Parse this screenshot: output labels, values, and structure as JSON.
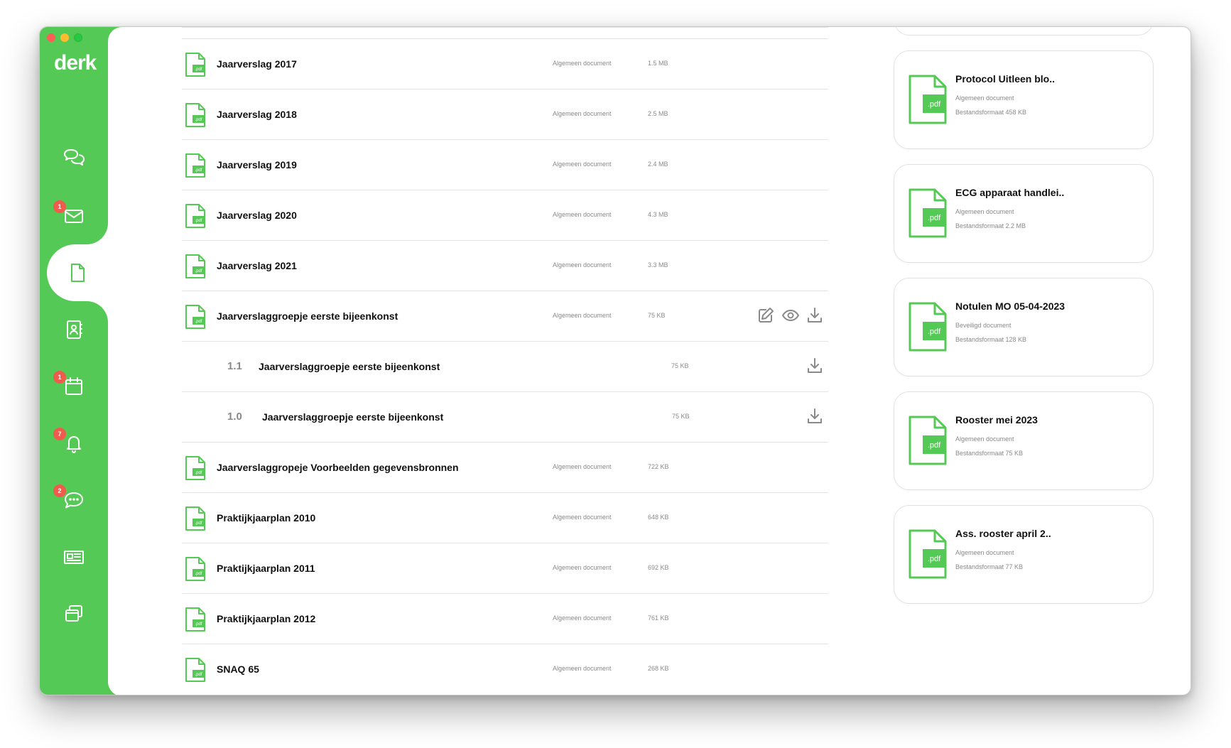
{
  "app": {
    "logo": "derk",
    "accent": "#55c955",
    "badge_color": "#ef5b4c"
  },
  "sidebar": {
    "items": [
      {
        "icon": "chat-bubbles-icon",
        "badge": ""
      },
      {
        "icon": "mail-icon",
        "badge": "1"
      },
      {
        "icon": "document-icon",
        "badge": "",
        "active": true
      },
      {
        "icon": "contacts-book-icon",
        "badge": ""
      },
      {
        "icon": "calendar-icon",
        "badge": "1"
      },
      {
        "icon": "bell-icon",
        "badge": "7"
      },
      {
        "icon": "message-icon",
        "badge": "2"
      },
      {
        "icon": "newspaper-icon",
        "badge": ""
      },
      {
        "icon": "windows-icon",
        "badge": ""
      }
    ]
  },
  "documents": [
    {
      "name": "Jaarverslag 2017",
      "type": "Algemeen document",
      "size": "1.5 MB",
      "icon_label": ".pdf"
    },
    {
      "name": "Jaarverslag 2018",
      "type": "Algemeen document",
      "size": "2.5 MB",
      "icon_label": ".pdf"
    },
    {
      "name": "Jaarverslag 2019",
      "type": "Algemeen document",
      "size": "2.4 MB",
      "icon_label": ".pdf"
    },
    {
      "name": "Jaarverslag 2020",
      "type": "Algemeen document",
      "size": "4.3 MB",
      "icon_label": ".pdf"
    },
    {
      "name": "Jaarverslag 2021",
      "type": "Algemeen document",
      "size": "3.3 MB",
      "icon_label": ".pdf"
    },
    {
      "name": "Jaarverslaggroepje eerste bijeenkonst",
      "type": "Algemeen document",
      "size": "75 KB",
      "icon_label": ".pdf",
      "actions": [
        "edit-icon",
        "eye-icon",
        "download-icon"
      ]
    },
    {
      "version": "1.1",
      "name": "Jaarverslaggroepje eerste bijeenkonst",
      "size": "75 KB"
    },
    {
      "version": "1.0",
      "name": "Jaarverslaggroepje eerste bijeenkonst",
      "size": "75 KB"
    },
    {
      "name": "Jaarverslaggropeje Voorbeelden gegevensbronnen",
      "type": "Algemeen document",
      "size": "722 KB",
      "icon_label": ".pdf"
    },
    {
      "name": "Praktijkjaarplan 2010",
      "type": "Algemeen document",
      "size": "648 KB",
      "icon_label": ".pdf"
    },
    {
      "name": "Praktijkjaarplan 2011",
      "type": "Algemeen document",
      "size": "692 KB",
      "icon_label": ".pdf"
    },
    {
      "name": "Praktijkjaarplan 2012",
      "type": "Algemeen document",
      "size": "761 KB",
      "icon_label": ".pdf"
    },
    {
      "name": "SNAQ 65",
      "type": "Algemeen document",
      "size": "268 KB",
      "icon_label": ".pdf"
    }
  ],
  "recent_cards": [
    {
      "title": "Protocol Uitleen blo..",
      "type": "Algemeen document",
      "size": "Bestandsformaat 458 KB",
      "icon_label": ".pdf"
    },
    {
      "title": "ECG apparaat handlei..",
      "type": "Algemeen document",
      "size": "Bestandsformaat 2.2 MB",
      "icon_label": ".pdf"
    },
    {
      "title": "Notulen MO 05-04-2023",
      "type": "Beveiligd document",
      "size": "Bestandsformaat 128 KB",
      "icon_label": ".pdf"
    },
    {
      "title": "Rooster mei 2023",
      "type": "Algemeen document",
      "size": "Bestandsformaat 75 KB",
      "icon_label": ".pdf"
    },
    {
      "title": "Ass. rooster april 2..",
      "type": "Algemeen document",
      "size": "Bestandsformaat 77 KB",
      "icon_label": ".pdf"
    }
  ]
}
